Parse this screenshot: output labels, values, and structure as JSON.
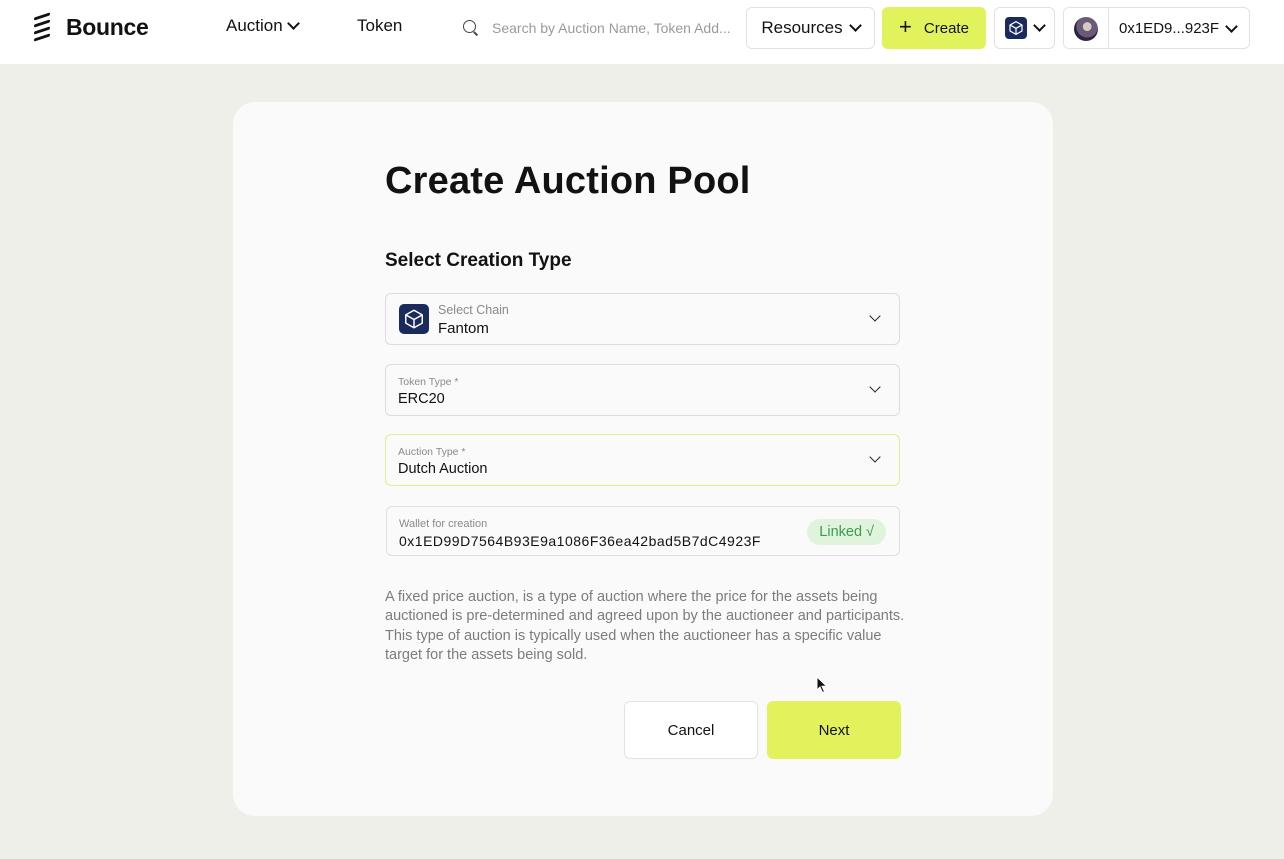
{
  "header": {
    "logo_text": "Bounce",
    "nav": {
      "auction_label": "Auction",
      "token_label": "Token"
    },
    "search": {
      "placeholder": "Search by Auction Name, Token Add..."
    },
    "resources_label": "Resources",
    "create_label": "Create",
    "account": {
      "address_short": "0x1ED9...923F"
    }
  },
  "page": {
    "title": "Create Auction Pool",
    "section_title": "Select Creation Type"
  },
  "form": {
    "chain": {
      "label": "Select Chain",
      "value": "Fantom"
    },
    "token_type": {
      "label": "Token Type *",
      "value": "ERC20"
    },
    "auction_type": {
      "label": "Auction Type *",
      "value": "Dutch Auction"
    },
    "wallet": {
      "label": "Wallet for creation",
      "value": "0x1ED99D7564B93E9a1086F36ea42bad5B7dC4923F",
      "status": "Linked √"
    }
  },
  "description": "A fixed price auction, is a type of auction where the price for the assets being auctioned is pre-determined and agreed upon by the auctioneer and participants. This type of auction is typically used when the auctioneer has a specific value target for the assets being sold.",
  "actions": {
    "cancel_label": "Cancel",
    "next_label": "Next"
  },
  "colors": {
    "accent": "#e1f25c",
    "background": "#efefea",
    "card": "#fafafa",
    "chain_icon_bg": "#1b2a5c",
    "linked_badge_bg": "#dff3dd",
    "linked_badge_text": "#3d9b4c"
  },
  "icons": {
    "logo": "bounce-logo-icon",
    "search": "search-icon",
    "chain": "fantom-cube-icon",
    "chevron": "chevron-down-icon",
    "plus": "plus-icon"
  }
}
